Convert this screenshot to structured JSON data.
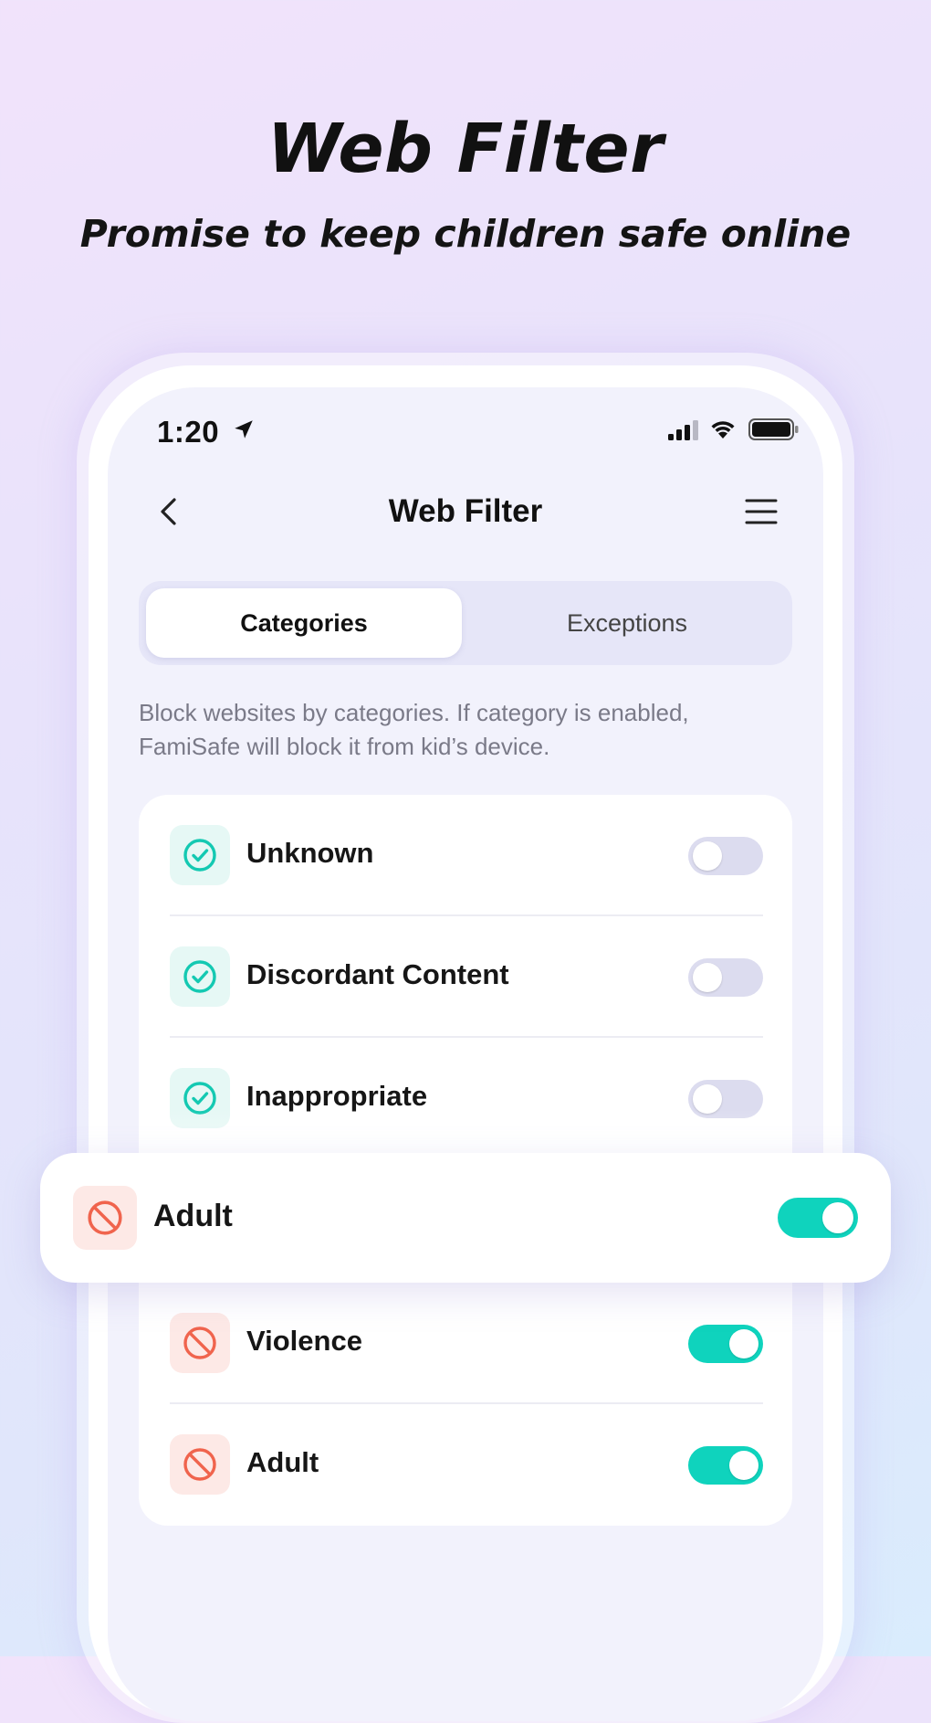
{
  "hero": {
    "title": "Web Filter",
    "subtitle": "Promise to keep children safe online"
  },
  "status_bar": {
    "time": "1:20",
    "icons": [
      "location-arrow-icon",
      "cellular-signal-icon",
      "wifi-icon",
      "battery-icon"
    ]
  },
  "nav": {
    "title": "Web Filter",
    "back_icon": "chevron-left-icon",
    "menu_icon": "hamburger-menu-icon"
  },
  "tabs": [
    {
      "label": "Categories",
      "active": true
    },
    {
      "label": "Exceptions",
      "active": false
    }
  ],
  "description": "Block websites by categories. If category is enabled, FamiSafe will block it from kid’s device.",
  "categories": [
    {
      "label": "Unknown",
      "icon": "check-circle-icon",
      "enabled": false
    },
    {
      "label": "Discordant Content",
      "icon": "check-circle-icon",
      "enabled": false
    },
    {
      "label": "Inappropriate",
      "icon": "check-circle-icon",
      "enabled": false
    },
    {
      "label": "Violence",
      "icon": "block-icon",
      "enabled": true
    },
    {
      "label": "Adult",
      "icon": "block-icon",
      "enabled": true
    }
  ],
  "highlighted_category": {
    "label": "Adult",
    "icon": "block-icon",
    "enabled": true
  },
  "colors": {
    "accent_teal": "#0fd3bd",
    "block_red": "#f0644d",
    "toggle_off": "#dcdcef"
  }
}
